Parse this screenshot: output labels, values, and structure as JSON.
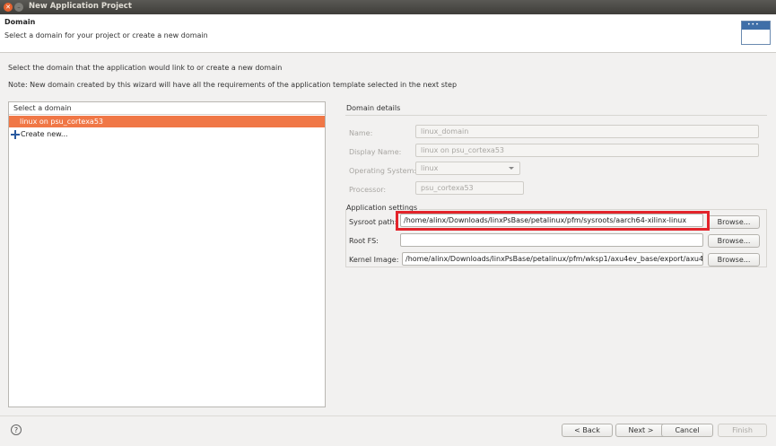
{
  "window": {
    "title": "New Application Project"
  },
  "header": {
    "title": "Domain",
    "subtitle": "Select a domain for your project or create a new domain"
  },
  "intro": {
    "line1": "Select the domain that the application would link to or create a new domain",
    "note": "Note: New domain created by this wizard will have all the requirements of the application template selected in the next step"
  },
  "domain_list": {
    "header": "Select a domain",
    "items": [
      "linux on psu_cortexa53"
    ],
    "create_label": "Create new..."
  },
  "details": {
    "title": "Domain details",
    "name_label": "Name:",
    "name_value": "linux_domain",
    "display_label": "Display Name:",
    "display_value": "linux on psu_cortexa53",
    "os_label": "Operating System:",
    "os_value": "linux",
    "proc_label": "Processor:",
    "proc_value": "psu_cortexa53"
  },
  "app_settings": {
    "title": "Application settings",
    "sysroot_label": "Sysroot path:",
    "sysroot_value": "/home/alinx/Downloads/linxPsBase/petalinux/pfm/sysroots/aarch64-xilinx-linux",
    "rootfs_label": "Root FS:",
    "rootfs_value": "",
    "kernel_label": "Kernel Image:",
    "kernel_value": "/home/alinx/Downloads/linxPsBase/petalinux/pfm/wksp1/axu4ev_base/export/axu4",
    "browse_label": "Browse..."
  },
  "footer": {
    "help_symbol": "?",
    "back_label": "< Back",
    "next_label": "Next >",
    "cancel_label": "Cancel",
    "finish_label": "Finish"
  },
  "colors": {
    "selection": "#f07746",
    "highlight_box": "#e3242b",
    "titlebar": "#3e3d39"
  }
}
